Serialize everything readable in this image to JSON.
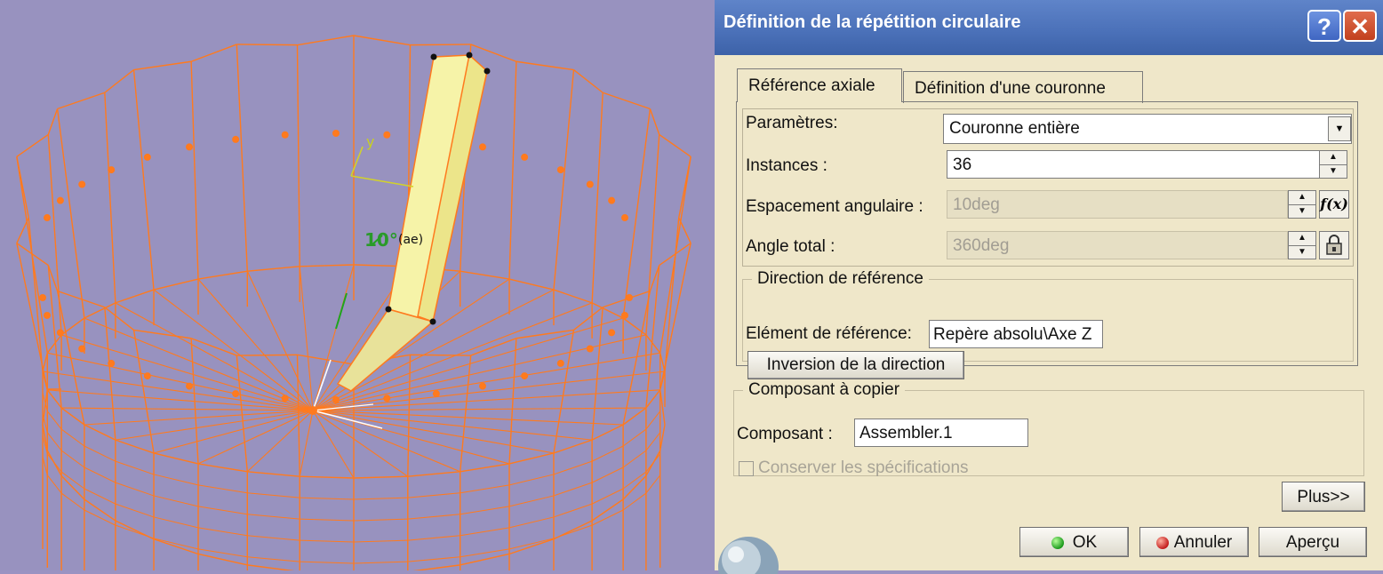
{
  "viewport": {
    "axis_label": "y",
    "angle_label": "10°",
    "tag_label": "(ae)"
  },
  "dialog": {
    "title": "Définition de la répétition circulaire",
    "help_glyph": "?",
    "close_glyph": "✕",
    "tabs": [
      {
        "label": "Référence axiale",
        "active": true
      },
      {
        "label": "Définition d'une couronne",
        "active": false
      }
    ],
    "params": {
      "parametres_label": "Paramètres:",
      "parametres_value": "Couronne entière",
      "instances_label": "Instances :",
      "instances_value": "36",
      "espacement_label": "Espacement angulaire :",
      "espacement_value": "10deg",
      "angle_label": "Angle total :",
      "angle_value": "360deg",
      "fx_glyph": "f(x)"
    },
    "direction": {
      "legend": "Direction de référence",
      "element_label": "Elément de référence:",
      "element_value": "Repère absolu\\Axe Z",
      "inversion_button": "Inversion de la direction"
    },
    "composant": {
      "legend": "Composant à copier",
      "composant_label": "Composant :",
      "composant_value": "Assembler.1",
      "conserver_label": "Conserver les spécifications",
      "conserver_checked": false
    },
    "buttons": {
      "plus": "Plus>>",
      "ok": "OK",
      "annuler": "Annuler",
      "apercu": "Aperçu"
    }
  }
}
